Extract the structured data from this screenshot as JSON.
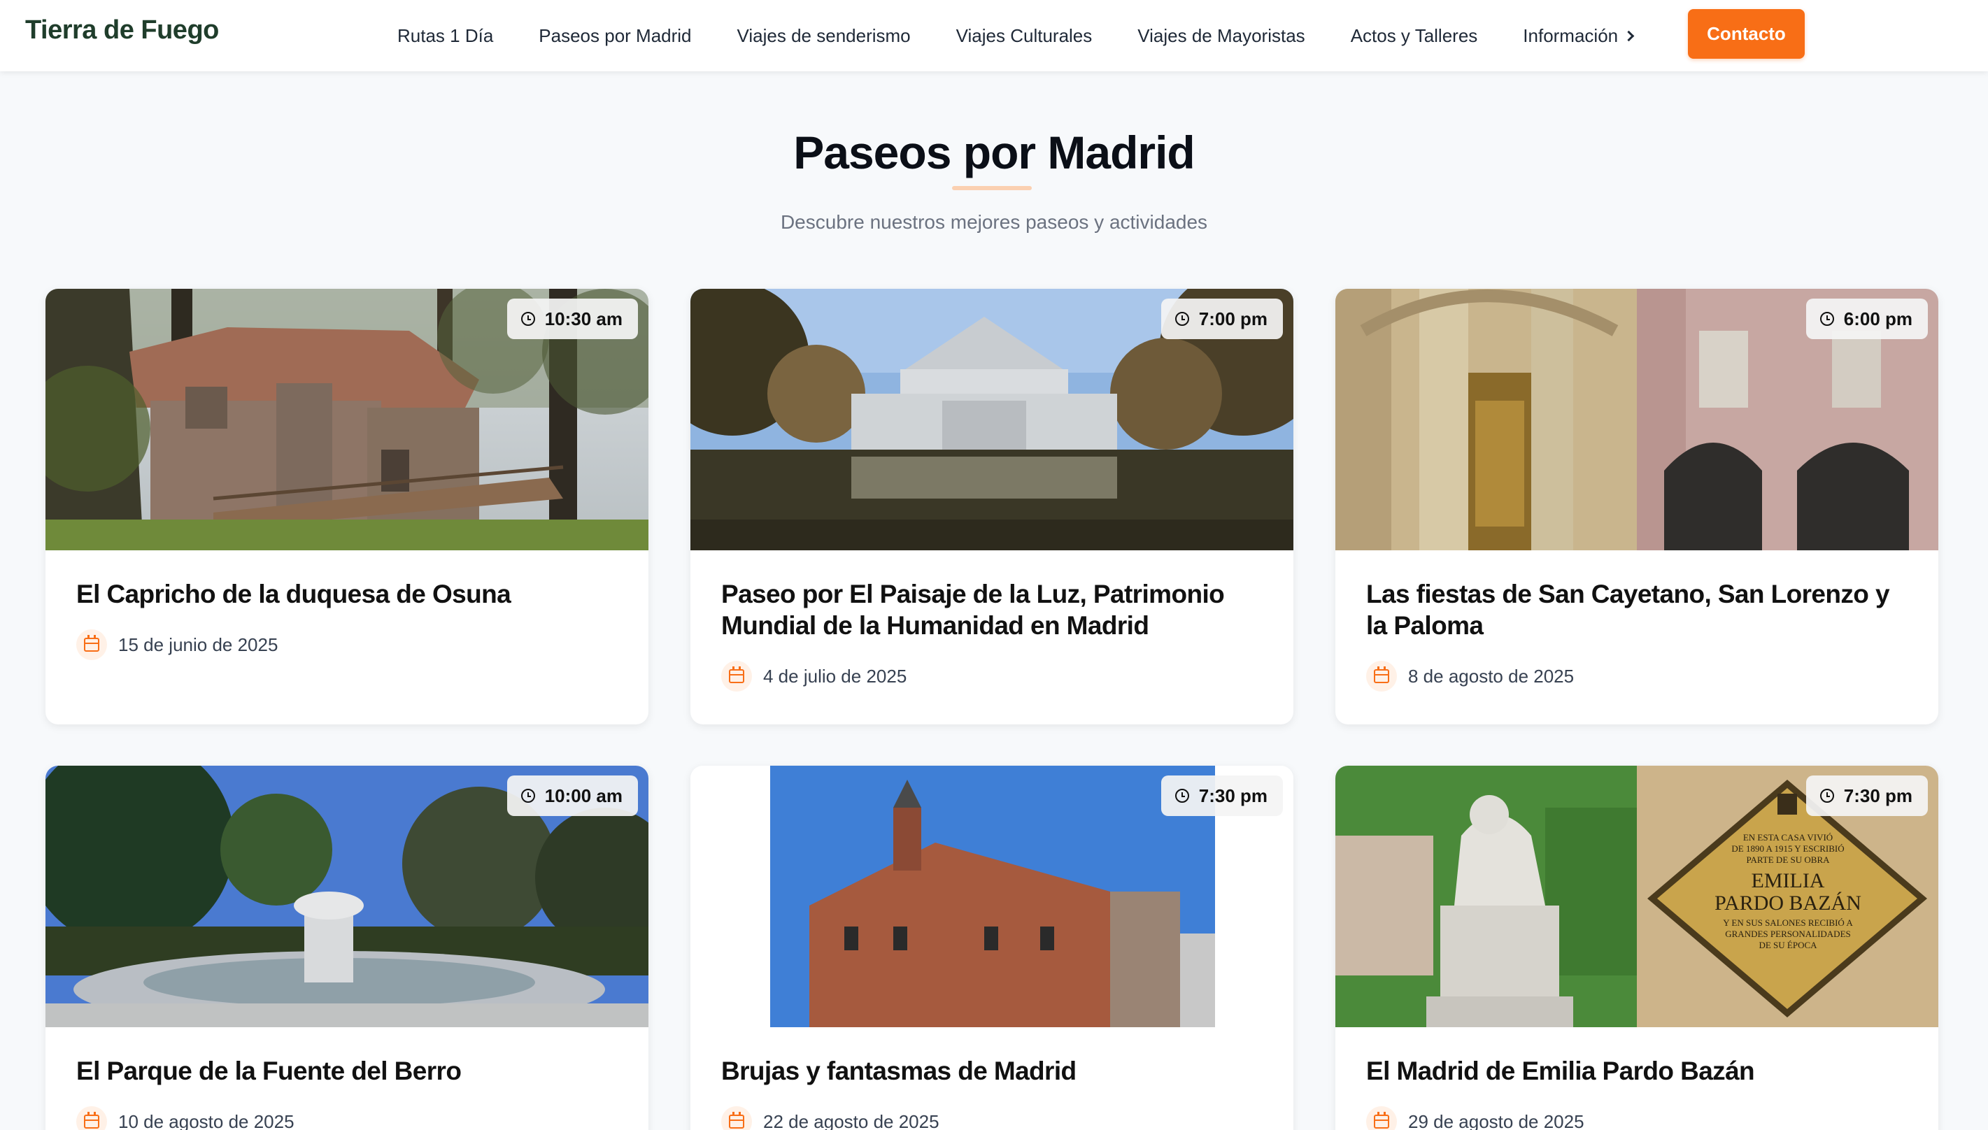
{
  "header": {
    "logo": "Tierra de Fuego",
    "nav": [
      {
        "label": "Rutas 1 Día"
      },
      {
        "label": "Paseos por Madrid"
      },
      {
        "label": "Viajes de senderismo"
      },
      {
        "label": "Viajes Culturales"
      },
      {
        "label": "Viajes de Mayoristas"
      },
      {
        "label": "Actos y Talleres"
      },
      {
        "label": "Información"
      }
    ],
    "contact": "Contacto"
  },
  "page": {
    "title": "Paseos por Madrid",
    "subtitle": "Descubre nuestros mejores paseos y actividades"
  },
  "cards": [
    {
      "time": "10:30 am",
      "title": "El Capricho de la duquesa de Osuna",
      "date": "15 de junio de 2025"
    },
    {
      "time": "7:00 pm",
      "title": "Paseo por El Paisaje de la Luz, Patrimonio Mundial de la Humanidad en Madrid",
      "date": "4 de julio de 2025"
    },
    {
      "time": "6:00 pm",
      "title": "Las fiestas de San Cayetano, San Lorenzo y la Paloma",
      "date": "8 de agosto de 2025"
    },
    {
      "time": "10:00 am",
      "title": "El Parque de la Fuente del Berro",
      "date": "10 de agosto de 2025"
    },
    {
      "time": "7:30 pm",
      "title": "Brujas y fantasmas de Madrid",
      "date": "22 de agosto de 2025"
    },
    {
      "time": "7:30 pm",
      "title": "El Madrid de Emilia Pardo Bazán",
      "date": "29 de agosto de 2025"
    }
  ],
  "plaque": {
    "line1": "EN ESTA CASA VIVIÓ",
    "line2": "DE 1890 A 1915 Y ESCRIBIÓ",
    "line3": "PARTE DE SU OBRA",
    "name1": "EMILIA",
    "name2": "PARDO BAZÁN",
    "line4": "Y EN SUS SALONES RECIBIÓ A",
    "line5": "GRANDES PERSONALIDADES",
    "line6": "DE SU ÉPOCA"
  },
  "colors": {
    "accent": "#f86e16",
    "logo": "#1f3d2b",
    "background": "#f7f9fb"
  },
  "icons": {
    "clock": "clock-icon",
    "calendar": "calendar-icon",
    "chevron": "chevron-right-icon"
  }
}
